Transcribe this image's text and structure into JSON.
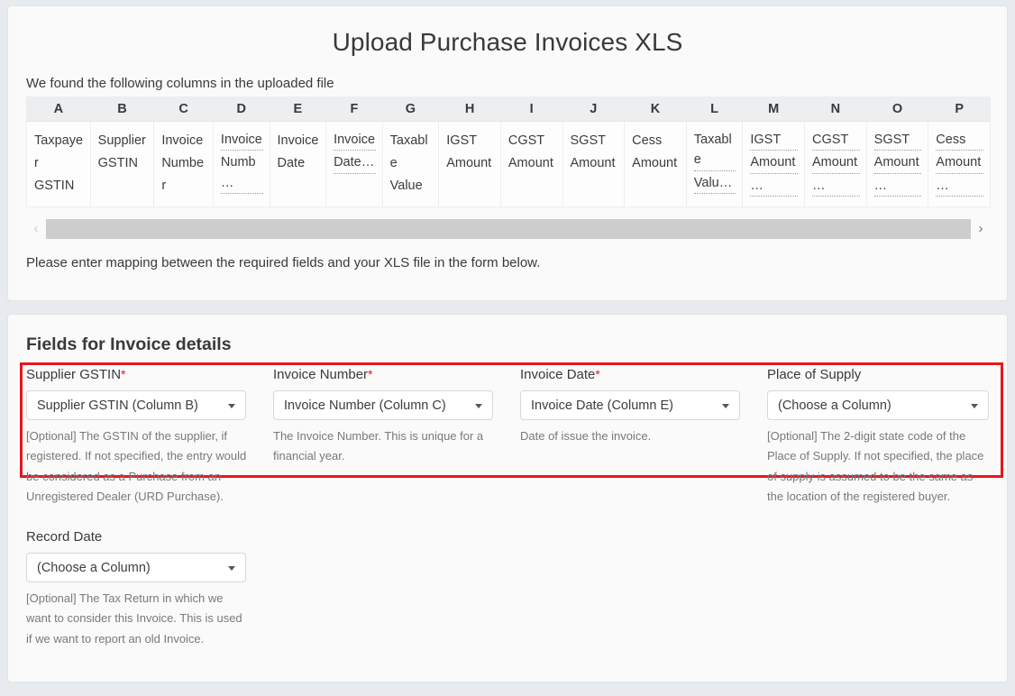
{
  "header": {
    "title": "Upload Purchase Invoices XLS",
    "intro": "We found the following columns in the uploaded file",
    "mapping_note": "Please enter mapping between the required fields and your XLS file in the form below."
  },
  "columns_table": {
    "letters": [
      "A",
      "B",
      "C",
      "D",
      "E",
      "F",
      "G",
      "H",
      "I",
      "J",
      "K",
      "L",
      "M",
      "N",
      "O",
      "P"
    ],
    "cells": [
      {
        "letter": "A",
        "lines": [
          "Taxpayer",
          "GSTIN"
        ],
        "truncated": false
      },
      {
        "letter": "B",
        "lines": [
          "Supplier",
          "GSTIN"
        ],
        "truncated": false
      },
      {
        "letter": "C",
        "lines": [
          "Invoice",
          "Number"
        ],
        "truncated": false
      },
      {
        "letter": "D",
        "lines": [
          "Invoice",
          "Numb…"
        ],
        "truncated": true
      },
      {
        "letter": "E",
        "lines": [
          "Invoice",
          "Date"
        ],
        "truncated": false
      },
      {
        "letter": "F",
        "lines": [
          "Invoice",
          "Date…"
        ],
        "truncated": true
      },
      {
        "letter": "G",
        "lines": [
          "Taxable",
          "Value"
        ],
        "truncated": false
      },
      {
        "letter": "H",
        "lines": [
          "IGST",
          "Amount"
        ],
        "truncated": false
      },
      {
        "letter": "I",
        "lines": [
          "CGST",
          "Amount"
        ],
        "truncated": false
      },
      {
        "letter": "J",
        "lines": [
          "SGST",
          "Amount"
        ],
        "truncated": false
      },
      {
        "letter": "K",
        "lines": [
          "Cess",
          "Amount"
        ],
        "truncated": false
      },
      {
        "letter": "L",
        "lines": [
          "Taxable",
          "Valu…"
        ],
        "truncated": true
      },
      {
        "letter": "M",
        "lines": [
          "IGST",
          "Amount",
          "…"
        ],
        "truncated": true
      },
      {
        "letter": "N",
        "lines": [
          "CGST",
          "Amount",
          "…"
        ],
        "truncated": true
      },
      {
        "letter": "O",
        "lines": [
          "SGST",
          "Amount",
          "…"
        ],
        "truncated": true
      },
      {
        "letter": "P",
        "lines": [
          "Cess",
          "Amount",
          "…"
        ],
        "truncated": true
      }
    ]
  },
  "scrollbar": {
    "left_arrow": "‹",
    "right_arrow": "›"
  },
  "fields_section": {
    "title": "Fields for Invoice details",
    "highlight_color": "#e8161c",
    "required_marker": "*",
    "fields": [
      {
        "label": "Supplier GSTIN",
        "required": true,
        "value": "Supplier GSTIN (Column B)",
        "help": "[Optional] The GSTIN of the supplier, if registered. If not specified, the entry would be considered as a Purchase from an Unregistered Dealer (URD Purchase)."
      },
      {
        "label": "Invoice Number",
        "required": true,
        "value": "Invoice Number (Column C)",
        "help": "The Invoice Number. This is unique for a financial year."
      },
      {
        "label": "Invoice Date",
        "required": true,
        "value": "Invoice Date (Column E)",
        "help": "Date of issue the invoice."
      },
      {
        "label": "Place of Supply",
        "required": false,
        "value": "(Choose a Column)",
        "help": "[Optional] The 2-digit state code of the Place of Supply. If not specified, the place of supply is assumed to be the same as the location of the registered buyer."
      }
    ],
    "record_date": {
      "label": "Record Date",
      "required": false,
      "value": "(Choose a Column)",
      "help": "[Optional] The Tax Return in which we want to consider this Invoice. This is used if we want to report an old Invoice."
    }
  }
}
